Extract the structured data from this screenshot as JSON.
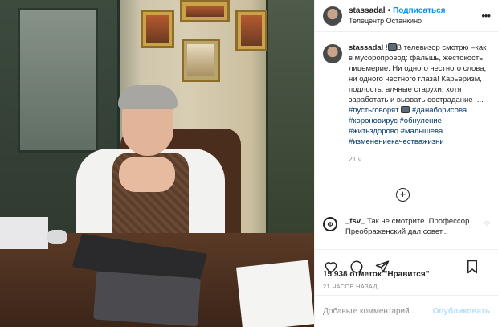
{
  "header": {
    "username": "stassadal",
    "separator": "•",
    "follow_label": "Подписаться",
    "location": "Телецентр Останкино",
    "more_icon": "more-icon"
  },
  "caption": {
    "username": "stassadal",
    "text_before_icon": "!",
    "icon": "tv-emoji",
    "text": "В телевизор смотрю –как в мусоропровод: фальшь, жестокость, лицемерие. Ни одного честного слова, ни одного честного глаза! Карьеризм, подлость, алчные старухи, хотят заработать и вызвать сострадание .... ",
    "hashtags": [
      "#пустьговорят",
      "#данаборисова",
      "#короновирус",
      "#обнуление",
      "#житьздорово",
      "#малышева",
      "#изменениекачестважизни"
    ],
    "time": "21 ч."
  },
  "load_more_icon": "plus-circle-icon",
  "comment": {
    "username": "_fsv_",
    "text": "Так не смотрите. Профессор Преображенский дал совет..."
  },
  "actions": {
    "like_icon": "heart-icon",
    "comment_icon": "comment-icon",
    "share_icon": "share-icon",
    "save_icon": "bookmark-icon"
  },
  "likes": "15 938 отметок \"Нравится\"",
  "posted_ago": "21 ЧАСОВ НАЗАД",
  "add_comment": {
    "placeholder": "Добавьте комментарий...",
    "publish_label": "Опубликовать"
  },
  "colors": {
    "accent": "#0095f6",
    "hashtag": "#00376b",
    "muted": "#8e8e8e",
    "publish_disabled": "#b2dffc"
  }
}
